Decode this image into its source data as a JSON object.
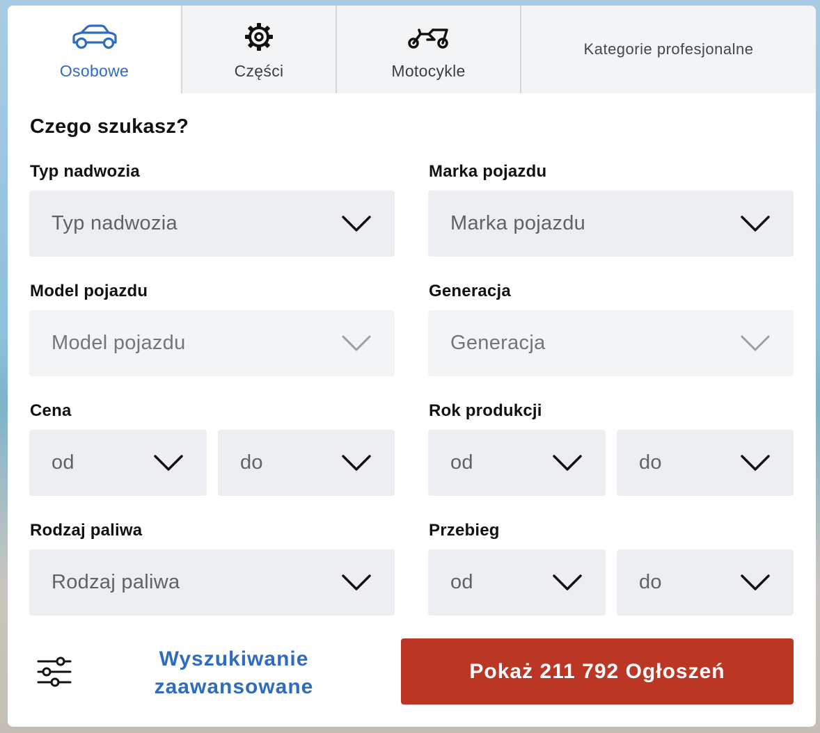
{
  "tabs": [
    {
      "label": "Osobowe",
      "icon": "car-icon",
      "active": true
    },
    {
      "label": "Części",
      "icon": "gear-icon",
      "active": false
    },
    {
      "label": "Motocykle",
      "icon": "motorcycle-icon",
      "active": false
    },
    {
      "label": "Kategorie profesjonalne",
      "icon": "",
      "active": false
    }
  ],
  "form": {
    "heading": "Czego szukasz?",
    "body_type": {
      "label": "Typ nadwozia",
      "placeholder": "Typ nadwozia"
    },
    "make": {
      "label": "Marka pojazdu",
      "placeholder": "Marka pojazdu"
    },
    "model": {
      "label": "Model pojazdu",
      "placeholder": "Model pojazdu",
      "disabled": true
    },
    "generation": {
      "label": "Generacja",
      "placeholder": "Generacja",
      "disabled": true
    },
    "price": {
      "label": "Cena",
      "from": "od",
      "to": "do"
    },
    "year": {
      "label": "Rok produkcji",
      "from": "od",
      "to": "do"
    },
    "fuel": {
      "label": "Rodzaj paliwa",
      "placeholder": "Rodzaj paliwa"
    },
    "mileage": {
      "label": "Przebieg",
      "from": "od",
      "to": "do"
    }
  },
  "actions": {
    "advanced_search": "Wyszukiwanie zaawansowane",
    "show_results": "Pokaż 211 792 Ogłoszeń"
  },
  "colors": {
    "accent_blue": "#2d6cc0",
    "primary_red": "#bc3625",
    "select_bg": "#eceef2"
  }
}
